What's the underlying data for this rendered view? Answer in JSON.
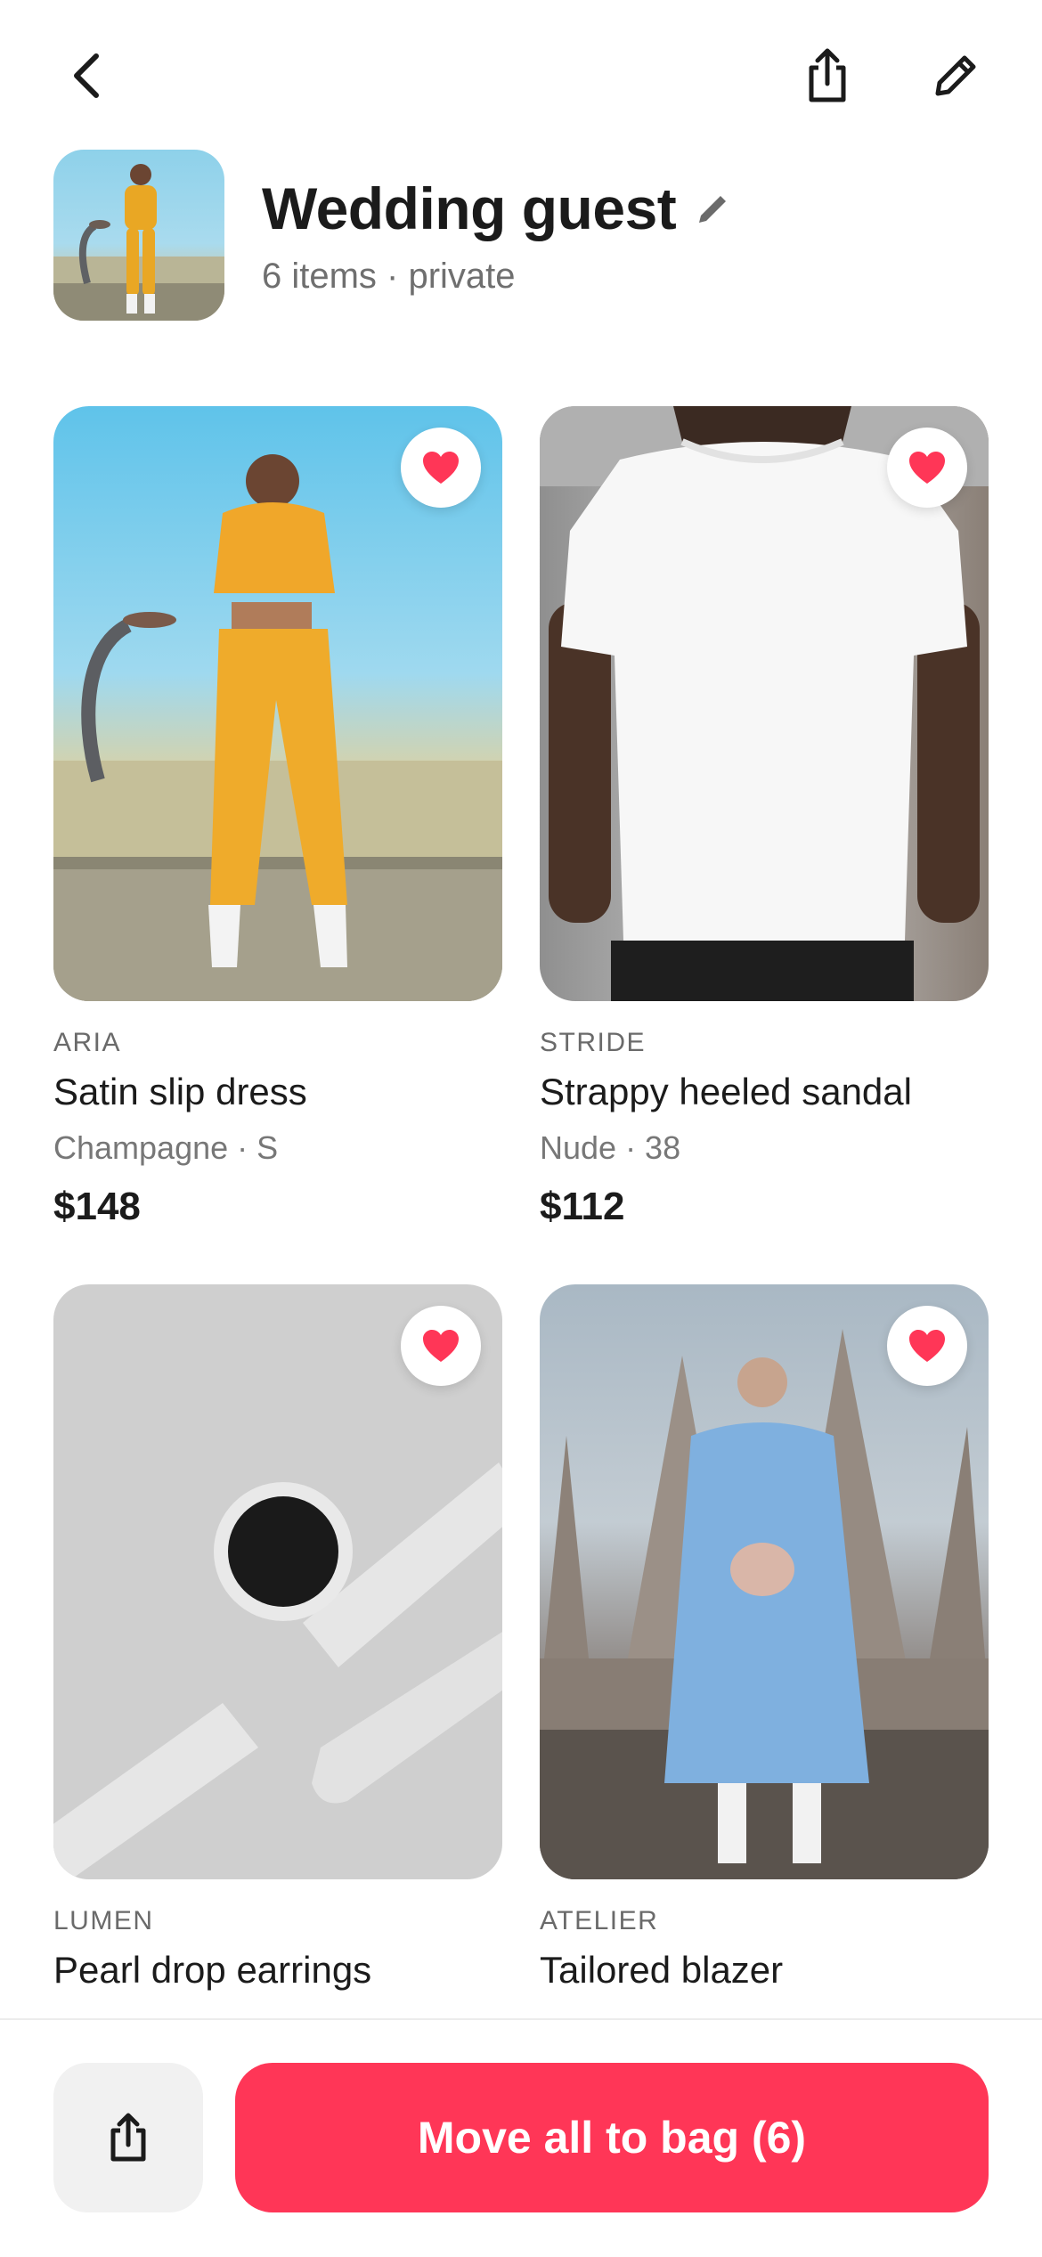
{
  "header": {
    "title": "Wedding guest",
    "meta": "6 items · private"
  },
  "icons": {
    "back": "chevron-left-icon",
    "share": "share-icon",
    "edit": "pencil-icon",
    "favorite": "heart-icon"
  },
  "colors": {
    "accent": "#ff3657",
    "heart": "#ff3657",
    "text": "#1b1b1b",
    "muted": "#6f6f6f"
  },
  "items": [
    {
      "brand": "ARIA",
      "name": "Satin slip dress",
      "variant": "Champagne · S",
      "price": "$148",
      "favorited": true
    },
    {
      "brand": "STRIDE",
      "name": "Strappy heeled sandal",
      "variant": "Nude · 38",
      "price": "$112",
      "favorited": true
    },
    {
      "brand": "LUMEN",
      "name": "Pearl drop earrings",
      "variant": "",
      "price": "",
      "favorited": true
    },
    {
      "brand": "ATELIER",
      "name": "Tailored blazer",
      "variant": "",
      "price": "",
      "favorited": true
    }
  ],
  "footer": {
    "cta_label": "Move all to bag (6)"
  }
}
